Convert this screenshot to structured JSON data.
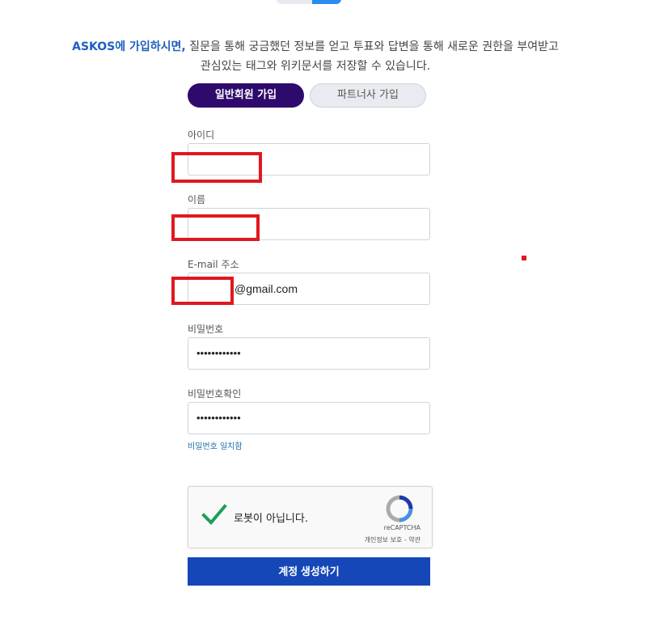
{
  "intro": {
    "brand": "ASKOS에 가입하시면,",
    "line1_rest": " 질문을 통해 궁금했던 정보를 얻고 투표와 답변을 통해 새로운 권한을 부여받고",
    "line2": "관심있는 태그와 위키문서를 저장할 수 있습니다."
  },
  "tabs": {
    "general": "일반회원 가입",
    "partner": "파트너사 가입"
  },
  "form": {
    "id_label": "아이디",
    "id_value": "",
    "name_label": "이름",
    "name_value": "",
    "email_label": "E-mail 주소",
    "email_value": "@gmail.com",
    "password_label": "비밀번호",
    "password_value": "••••••••••••",
    "confirm_label": "비밀번호확인",
    "confirm_value": "••••••••••••",
    "match_hint": "비밀번호 일치함"
  },
  "captcha": {
    "label": "로봇이 아닙니다.",
    "brand": "reCAPTCHA",
    "terms": "개인정보 보호 - 약관"
  },
  "submit_label": "계정 생성하기",
  "colors": {
    "accent_tab": "#2d0a6b",
    "submit": "#1547b8",
    "brand_text": "#1f5fbf",
    "redaction": "#e0181f"
  }
}
